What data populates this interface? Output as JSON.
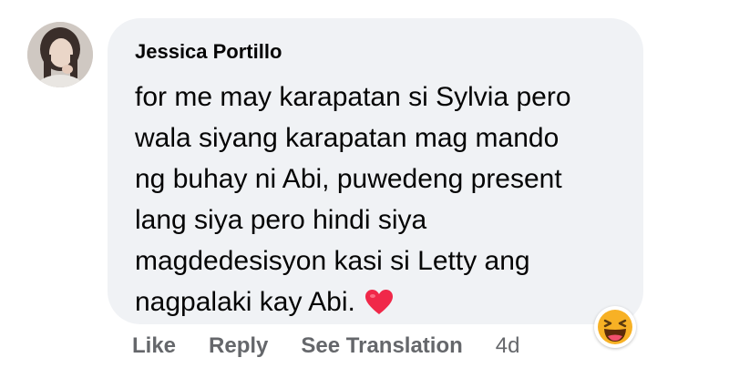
{
  "comment": {
    "author": "Jessica Portillo",
    "lines": [
      "for me may karapatan si Sylvia pero",
      "wala siyang karapatan mag mando",
      "ng buhay ni Abi, puwedeng present",
      "lang siya pero hindi siya",
      "magdedesisyon kasi si Letty ang",
      "nagpalaki kay Abi."
    ],
    "emoji": "heart-icon",
    "reaction": "laughing-face-icon"
  },
  "actions": {
    "like": "Like",
    "reply": "Reply",
    "see_translation": "See Translation",
    "timestamp": "4d"
  },
  "colors": {
    "bubble": "#f0f2f5",
    "text": "#050505",
    "secondary": "#65676b",
    "heart": "#f02849",
    "reaction": "#f7b125"
  }
}
